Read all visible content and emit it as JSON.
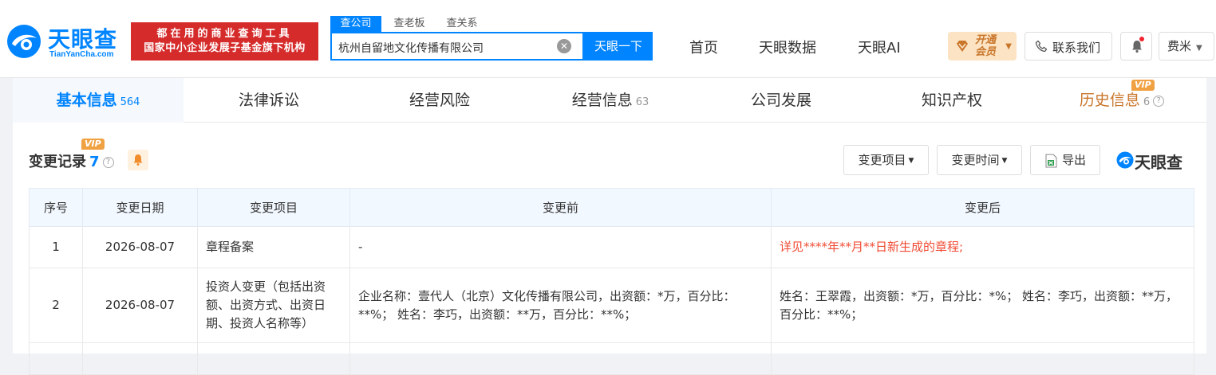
{
  "header": {
    "logo_cn": "天眼查",
    "logo_en": "TianYanCha.com",
    "banner_line1": "都在用的商业查询工具",
    "banner_line2": "国家中小企业发展子基金旗下机构",
    "search_tabs": [
      "查公司",
      "查老板",
      "查关系"
    ],
    "search_value": "杭州自留地文化传播有限公司",
    "search_button": "天眼一下",
    "nav": [
      "首页",
      "天眼数据",
      "天眼AI"
    ],
    "vip_line1": "开通",
    "vip_line2": "会员",
    "contact": "联系我们",
    "user": "费米"
  },
  "tabs": [
    {
      "label": "基本信息",
      "count": "564"
    },
    {
      "label": "法律诉讼",
      "count": ""
    },
    {
      "label": "经营风险",
      "count": ""
    },
    {
      "label": "经营信息",
      "count": "63"
    },
    {
      "label": "公司发展",
      "count": ""
    },
    {
      "label": "知识产权",
      "count": ""
    },
    {
      "label": "历史信息",
      "count": "6"
    }
  ],
  "vip_badge": "VIP",
  "section": {
    "title": "变更记录",
    "count": "7",
    "filter_item": "变更项目",
    "filter_time": "变更时间",
    "export": "导出",
    "brand": "天眼查"
  },
  "table": {
    "headers": [
      "序号",
      "变更日期",
      "变更项目",
      "变更前",
      "变更后"
    ],
    "rows": [
      {
        "no": "1",
        "date": "2026-08-07",
        "item": "章程备案",
        "before": "-",
        "after": "详见****年**月**日新生成的章程;"
      },
      {
        "no": "2",
        "date": "2026-08-07",
        "item": "投资人变更（包括出资额、出资方式、出资日期、投资人名称等）",
        "before": "企业名称：壹代人（北京）文化传播有限公司，出资额：*万，百分比：**%； 姓名：李巧，出资额：**万，百分比：**%；",
        "after": "姓名：王翠霞，出资额：*万，百分比：*%； 姓名：李巧，出资额：**万，百分比：**%；"
      }
    ]
  }
}
